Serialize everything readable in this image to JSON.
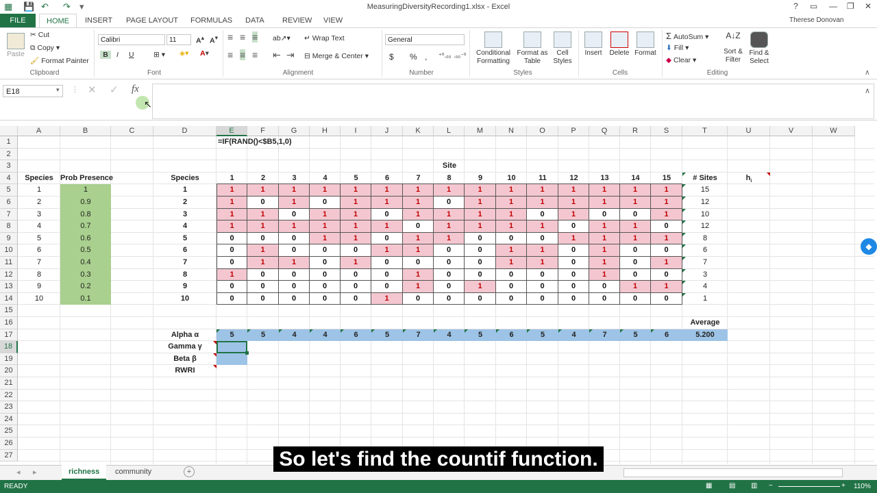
{
  "window": {
    "title": "MeasuringDiversityRecording1.xlsx - Excel",
    "user": "Therese Donovan",
    "help": "?"
  },
  "ribbon_tabs": [
    "FILE",
    "HOME",
    "INSERT",
    "PAGE LAYOUT",
    "FORMULAS",
    "DATA",
    "REVIEW",
    "VIEW"
  ],
  "ribbon": {
    "clipboard": {
      "paste": "Paste",
      "cut": "Cut",
      "copy": "Copy",
      "format_painter": "Format Painter",
      "label": "Clipboard"
    },
    "font": {
      "name": "Calibri",
      "size": "11",
      "bold": "B",
      "italic": "I",
      "underline": "U",
      "label": "Font"
    },
    "alignment": {
      "wrap_text": "Wrap Text",
      "merge_center": "Merge & Center",
      "label": "Alignment"
    },
    "number": {
      "format": "General",
      "currency": "$",
      "percent": "%",
      "comma": ",",
      "label": "Number"
    },
    "styles": {
      "conditional": "Conditional Formatting",
      "format_table": "Format as Table",
      "cell_styles": "Cell Styles",
      "label": "Styles"
    },
    "cells": {
      "insert": "Insert",
      "delete": "Delete",
      "format": "Format",
      "label": "Cells"
    },
    "editing": {
      "autosum": "AutoSum",
      "fill": "Fill",
      "clear": "Clear",
      "sort_filter": "Sort & Filter",
      "find_select": "Find & Select",
      "label": "Editing"
    }
  },
  "formula_bar": {
    "name_box": "E18",
    "fx": "fx",
    "formula": ""
  },
  "columns": [
    "A",
    "B",
    "C",
    "D",
    "E",
    "F",
    "G",
    "H",
    "I",
    "J",
    "K",
    "L",
    "M",
    "N",
    "O",
    "P",
    "Q",
    "R",
    "S",
    "T",
    "U",
    "V",
    "W"
  ],
  "rows": [
    "1",
    "2",
    "3",
    "4",
    "5",
    "6",
    "7",
    "8",
    "9",
    "10",
    "11",
    "12",
    "13",
    "14",
    "15",
    "16",
    "17",
    "18",
    "19",
    "20",
    "21",
    "22",
    "23",
    "24",
    "25",
    "26",
    "27"
  ],
  "sheet": {
    "e1_formula": "=IF(RAND()<$B5,1,0)",
    "site_header": "Site",
    "species_header_a": "Species",
    "prob_header": "Prob Presence",
    "species_header_d": "Species",
    "sites_header": "# Sites",
    "h_header": "h",
    "h_sub": "i",
    "site_numbers": [
      "1",
      "2",
      "3",
      "4",
      "5",
      "6",
      "7",
      "8",
      "9",
      "10",
      "11",
      "12",
      "13",
      "14",
      "15"
    ],
    "species": [
      "1",
      "2",
      "3",
      "4",
      "5",
      "6",
      "7",
      "8",
      "9",
      "10"
    ],
    "prob_presence": [
      "1",
      "0.9",
      "0.8",
      "0.7",
      "0.6",
      "0.5",
      "0.4",
      "0.3",
      "0.2",
      "0.1"
    ],
    "matrix": [
      [
        1,
        1,
        1,
        1,
        1,
        1,
        1,
        1,
        1,
        1,
        1,
        1,
        1,
        1,
        1
      ],
      [
        1,
        0,
        1,
        0,
        1,
        1,
        1,
        0,
        1,
        1,
        1,
        1,
        1,
        1,
        1
      ],
      [
        1,
        1,
        0,
        1,
        1,
        0,
        1,
        1,
        1,
        1,
        0,
        1,
        0,
        0,
        1
      ],
      [
        1,
        1,
        1,
        1,
        1,
        1,
        0,
        1,
        1,
        1,
        1,
        0,
        1,
        1,
        0
      ],
      [
        0,
        0,
        0,
        1,
        1,
        0,
        1,
        1,
        0,
        0,
        0,
        1,
        1,
        1,
        1
      ],
      [
        0,
        1,
        0,
        0,
        0,
        1,
        1,
        0,
        0,
        1,
        1,
        0,
        1,
        0,
        0
      ],
      [
        0,
        1,
        1,
        0,
        1,
        0,
        0,
        0,
        0,
        1,
        1,
        0,
        1,
        0,
        1
      ],
      [
        1,
        0,
        0,
        0,
        0,
        0,
        1,
        0,
        0,
        0,
        0,
        0,
        1,
        0,
        0
      ],
      [
        0,
        0,
        0,
        0,
        0,
        0,
        1,
        0,
        1,
        0,
        0,
        0,
        0,
        1,
        1
      ],
      [
        0,
        0,
        0,
        0,
        0,
        1,
        0,
        0,
        0,
        0,
        0,
        0,
        0,
        0,
        0
      ]
    ],
    "num_sites": [
      "15",
      "12",
      "10",
      "12",
      "8",
      "6",
      "7",
      "3",
      "4",
      "1"
    ],
    "average_label": "Average",
    "alpha_label": "Alpha α",
    "alpha_values": [
      "5",
      "5",
      "4",
      "4",
      "6",
      "5",
      "7",
      "4",
      "5",
      "6",
      "5",
      "4",
      "7",
      "5",
      "6"
    ],
    "alpha_average": "5.200",
    "gamma_label": "Gamma γ",
    "beta_label": "Beta β",
    "rwri_label": "RWRI"
  },
  "sheet_tabs": [
    "richness",
    "community"
  ],
  "status": {
    "ready": "READY",
    "zoom": "110%"
  },
  "subtitle": "So let's find the countif function.",
  "colors": {
    "excel_green": "#217346",
    "pink": "#f4c7d0",
    "green_fill": "#a9d08e",
    "blue_fill": "#9dc3e6"
  }
}
